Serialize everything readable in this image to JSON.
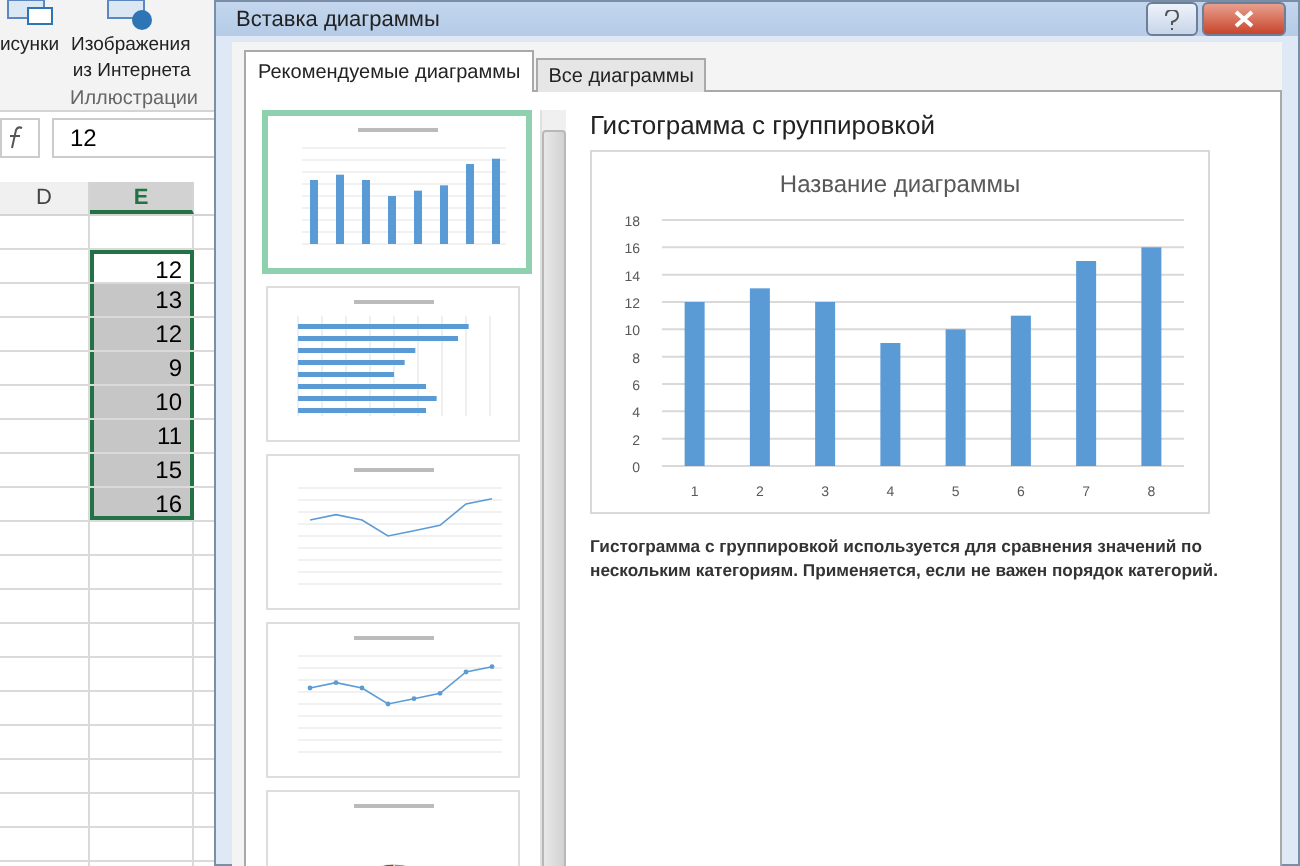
{
  "ribbon": {
    "buttons": [
      {
        "label": "исунки",
        "kind": "pictures"
      },
      {
        "label": "Изображения\nиз Интернета",
        "kind": "online"
      }
    ],
    "group_label": "Иллюстрации"
  },
  "formula_bar": {
    "value": "12"
  },
  "sheet": {
    "columns": [
      {
        "label": "D",
        "selected": false
      },
      {
        "label": "E",
        "selected": true
      }
    ],
    "cells": [
      {
        "value": "12",
        "active": true
      },
      {
        "value": "13",
        "active": false
      },
      {
        "value": "12",
        "active": false
      },
      {
        "value": "9",
        "active": false
      },
      {
        "value": "10",
        "active": false
      },
      {
        "value": "11",
        "active": false
      },
      {
        "value": "15",
        "active": false
      },
      {
        "value": "16",
        "active": false
      }
    ]
  },
  "dialog": {
    "title": "Вставка диаграммы",
    "tabs": [
      {
        "label": "Рекомендуемые диаграммы",
        "selected": true
      },
      {
        "label": "Все диаграммы",
        "selected": false
      }
    ],
    "thumbnails": [
      {
        "kind": "column",
        "selected": true
      },
      {
        "kind": "bar",
        "selected": false
      },
      {
        "kind": "line",
        "selected": false
      },
      {
        "kind": "line_markers",
        "selected": false
      },
      {
        "kind": "pie",
        "selected": false
      }
    ],
    "preview_title": "Гистограмма с группировкой",
    "chart_data": {
      "type": "bar",
      "title": "Название диаграммы",
      "categories": [
        "1",
        "2",
        "3",
        "4",
        "5",
        "6",
        "7",
        "8"
      ],
      "series": [
        {
          "color": "#5b9bd5",
          "values": [
            12,
            13,
            12,
            9,
            10,
            11,
            15,
            16
          ]
        }
      ],
      "grid": true,
      "ylim": [
        0,
        18
      ],
      "yticks": [
        0,
        2,
        4,
        6,
        8,
        10,
        12,
        14,
        16,
        18
      ]
    },
    "description": "Гистограмма с группировкой используется для сравнения значений по нескольким категориям. Применяется, если не важен порядок категорий."
  }
}
